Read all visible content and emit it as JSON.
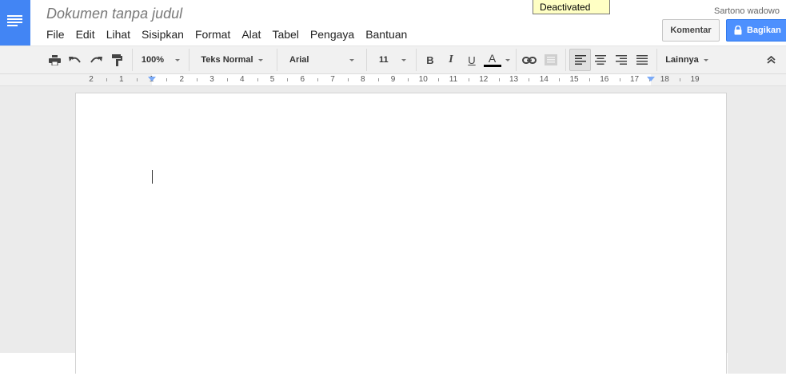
{
  "document": {
    "title": "Dokumen tanpa judul"
  },
  "menu": [
    "File",
    "Edit",
    "Lihat",
    "Sisipkan",
    "Format",
    "Alat",
    "Tabel",
    "Pengaya",
    "Bantuan"
  ],
  "tooltip": {
    "text": "Deactivated"
  },
  "user": {
    "name": "Sartono wadowo"
  },
  "buttons": {
    "comment": "Komentar",
    "share": "Bagikan"
  },
  "toolbar": {
    "zoom": "100%",
    "style": "Teks Normal",
    "font": "Arial",
    "font_size": "11",
    "bold": "B",
    "italic": "I",
    "underline": "U",
    "text_color": "A",
    "more": "Lainnya"
  },
  "ruler": {
    "labels": [
      "2",
      "1",
      "1",
      "2",
      "3",
      "4",
      "5",
      "6",
      "7",
      "8",
      "9",
      "10",
      "11",
      "12",
      "13",
      "14",
      "15",
      "16",
      "17",
      "18",
      "19"
    ]
  },
  "colors": {
    "brand": "#4285f4",
    "share_button": "#4d90fe",
    "text_color_bar": "#000000"
  },
  "icons": [
    "docs-logo-icon",
    "print-icon",
    "undo-icon",
    "redo-icon",
    "paint-format-icon",
    "bold-icon",
    "italic-icon",
    "underline-icon",
    "text-color-icon",
    "link-icon",
    "comment-icon",
    "align-left-icon",
    "align-center-icon",
    "align-right-icon",
    "align-justify-icon",
    "collapse-icon",
    "lock-icon"
  ]
}
